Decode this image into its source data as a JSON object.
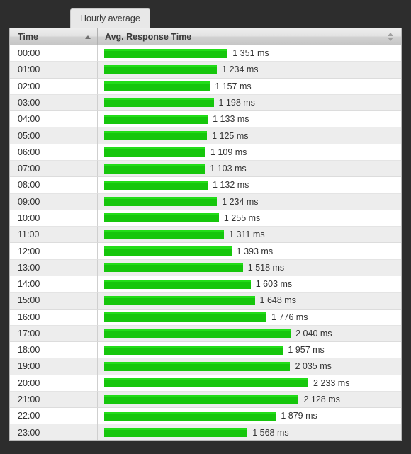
{
  "tab": {
    "label": "Hourly average",
    "name": "hourly-average-tab"
  },
  "table": {
    "columns": [
      {
        "key": "time",
        "label": "Time",
        "sort": "asc",
        "sort_icon": "triangle-up-icon"
      },
      {
        "key": "response",
        "label": "Avg. Response Time",
        "sort": "none",
        "sort_icon": "sort-both-icon"
      }
    ]
  },
  "chart_data": {
    "type": "bar",
    "title": "Hourly average",
    "xlabel": "Avg. Response Time",
    "ylabel": "Time",
    "unit": "ms",
    "orientation": "horizontal",
    "grid": false,
    "legend": false,
    "bar_color": "#16c60c",
    "bar_highlight_color": "#22dd18",
    "xlim": [
      0,
      2233
    ],
    "categories": [
      "00:00",
      "01:00",
      "02:00",
      "03:00",
      "04:00",
      "05:00",
      "06:00",
      "07:00",
      "08:00",
      "09:00",
      "10:00",
      "11:00",
      "12:00",
      "13:00",
      "14:00",
      "15:00",
      "16:00",
      "17:00",
      "18:00",
      "19:00",
      "20:00",
      "21:00",
      "22:00",
      "23:00"
    ],
    "values": [
      1351,
      1234,
      1157,
      1198,
      1133,
      1125,
      1109,
      1103,
      1132,
      1234,
      1255,
      1311,
      1393,
      1518,
      1603,
      1648,
      1776,
      2040,
      1957,
      2035,
      2233,
      2128,
      1879,
      1568
    ],
    "value_labels": [
      "1 351 ms",
      "1 234 ms",
      "1 157 ms",
      "1 198 ms",
      "1 133 ms",
      "1 125 ms",
      "1 109 ms",
      "1 103 ms",
      "1 132 ms",
      "1 234 ms",
      "1 255 ms",
      "1 311 ms",
      "1 393 ms",
      "1 518 ms",
      "1 603 ms",
      "1 648 ms",
      "1 776 ms",
      "2 040 ms",
      "1 957 ms",
      "2 035 ms",
      "2 233 ms",
      "2 128 ms",
      "1 879 ms",
      "1 568 ms"
    ]
  }
}
